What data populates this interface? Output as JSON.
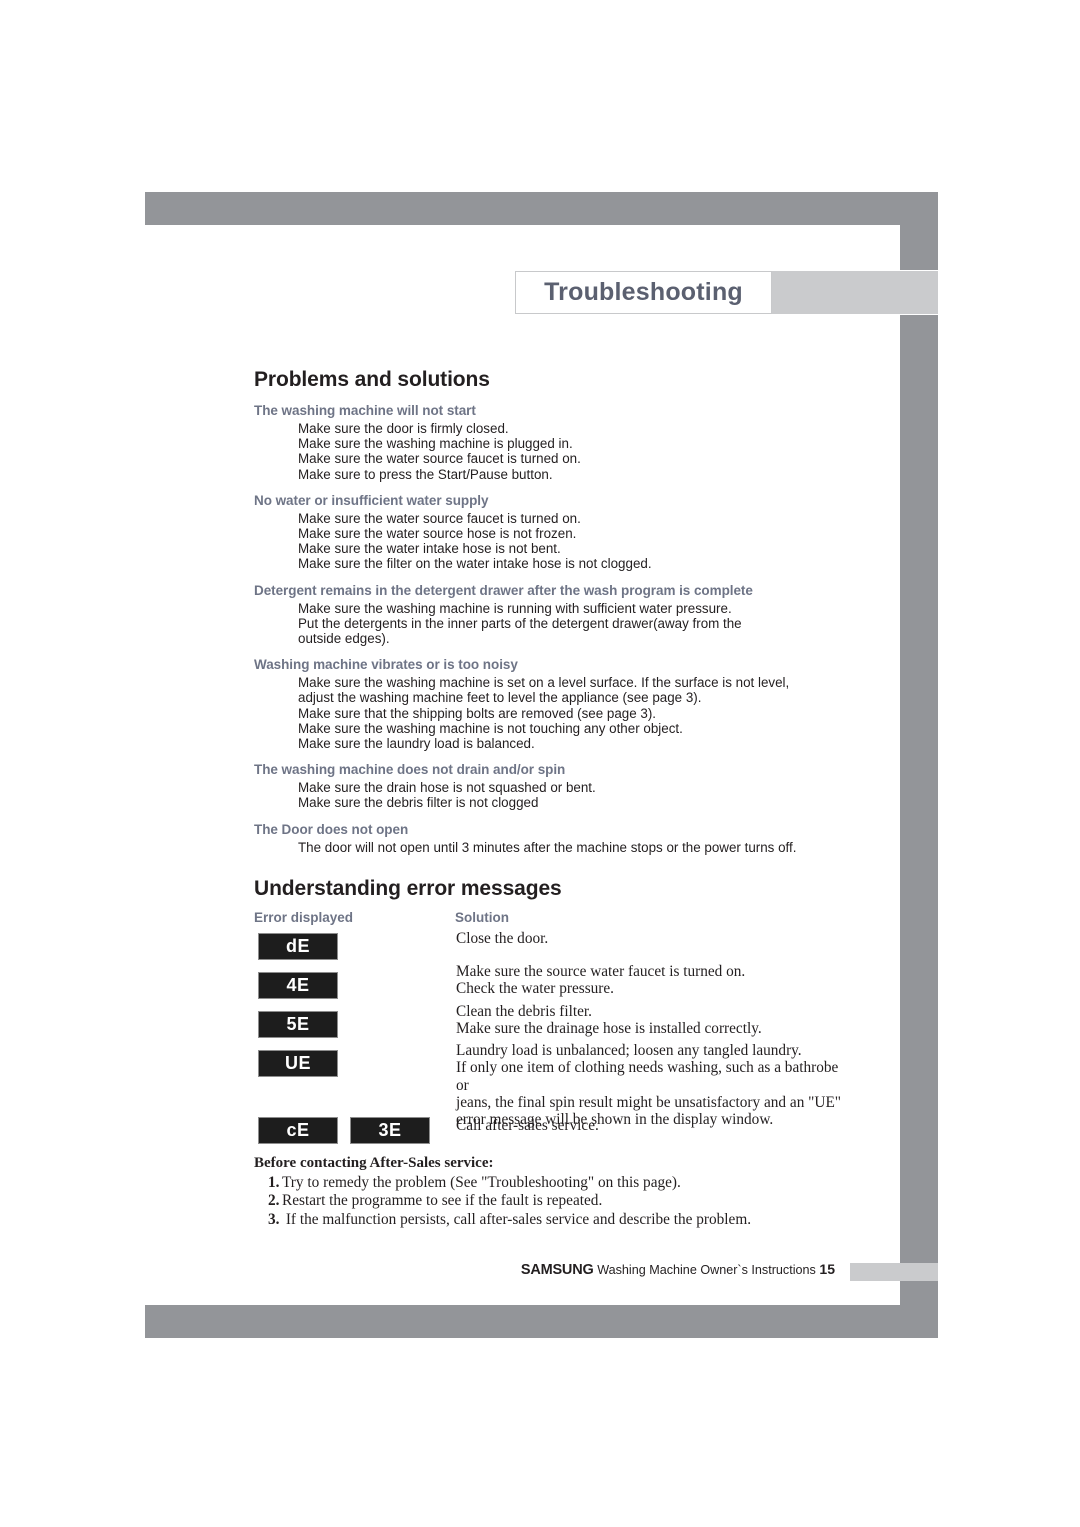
{
  "chapter": {
    "title": "Troubleshooting"
  },
  "sections": {
    "problems_title": "Problems and solutions",
    "errors_title": "Understanding error messages"
  },
  "problems": [
    {
      "heading": "The washing machine will not start",
      "items": [
        "Make sure the door is firmly closed.",
        "Make sure the washing machine is plugged in.",
        "Make sure the water source faucet is turned on.",
        "Make sure to press the Start/Pause button."
      ]
    },
    {
      "heading": "No water or insufficient water supply",
      "items": [
        "Make sure the water source faucet is turned on.",
        "Make sure the water source hose is not frozen.",
        "Make sure the water intake hose is not bent.",
        "Make sure the filter on the water intake hose is not clogged."
      ]
    },
    {
      "heading": "Detergent remains in the detergent drawer after the wash program is complete",
      "items": [
        "Make sure the washing machine is running with sufficient water pressure.",
        "Put the detergents in the inner parts of the detergent drawer(away from the\noutside edges)."
      ]
    },
    {
      "heading": "Washing machine vibrates or is too noisy",
      "items": [
        "Make sure the washing machine is set on a level surface.  If the surface is not level,\nadjust the washing machine feet to level the appliance (see page 3).",
        "Make sure that the shipping bolts are removed (see page 3).",
        "Make sure the washing machine is not touching any other object.",
        "Make sure the laundry load is balanced."
      ]
    },
    {
      "heading": "The washing machine does not drain and/or spin",
      "items": [
        "Make sure the drain hose is not squashed or bent.",
        "Make sure the debris filter is not clogged"
      ]
    },
    {
      "heading": "The Door does not open",
      "items": [
        "The door will not open until 3 minutes after the machine stops or the power turns off."
      ]
    }
  ],
  "error_table": {
    "col_error": "Error displayed",
    "col_solution": "Solution",
    "rows": [
      {
        "codes": [
          "dE"
        ],
        "solution": "Close the door."
      },
      {
        "codes": [
          "4E"
        ],
        "solution": "Make sure the source water faucet is turned on.\nCheck the water pressure."
      },
      {
        "codes": [
          "5E"
        ],
        "solution": "Clean the debris filter.\nMake sure the drainage hose is installed correctly."
      },
      {
        "codes": [
          "UE"
        ],
        "solution": "Laundry load is unbalanced; loosen any tangled laundry.\nIf only one item of clothing needs washing, such as a bathrobe or\njeans, the final spin result might be unsatisfactory and an \"UE\"\nerror message will be shown in the display window."
      },
      {
        "codes": [
          "cE",
          "3E"
        ],
        "solution": "Call after-sales service."
      }
    ]
  },
  "before_contacting": {
    "heading": "Before contacting After-Sales service:",
    "steps": [
      {
        "num": "1.",
        "text": "Try to remedy the problem (See \"Troubleshooting\" on this page)."
      },
      {
        "num": "2.",
        "text": "Restart the programme to see if the fault is repeated."
      },
      {
        "num": "3.",
        "text": " If the malfunction persists, call after-sales service and describe the problem."
      }
    ]
  },
  "footer": {
    "brand": "SAMSUNG",
    "text": "Washing Machine Owner`s Instructions",
    "page": "15"
  },
  "colors": {
    "frame_gray": "#939599",
    "band_gray": "#cacbcd",
    "subheading": "#6e7486",
    "title_text": "#5b6070",
    "code_bg": "#1d1d1d"
  }
}
